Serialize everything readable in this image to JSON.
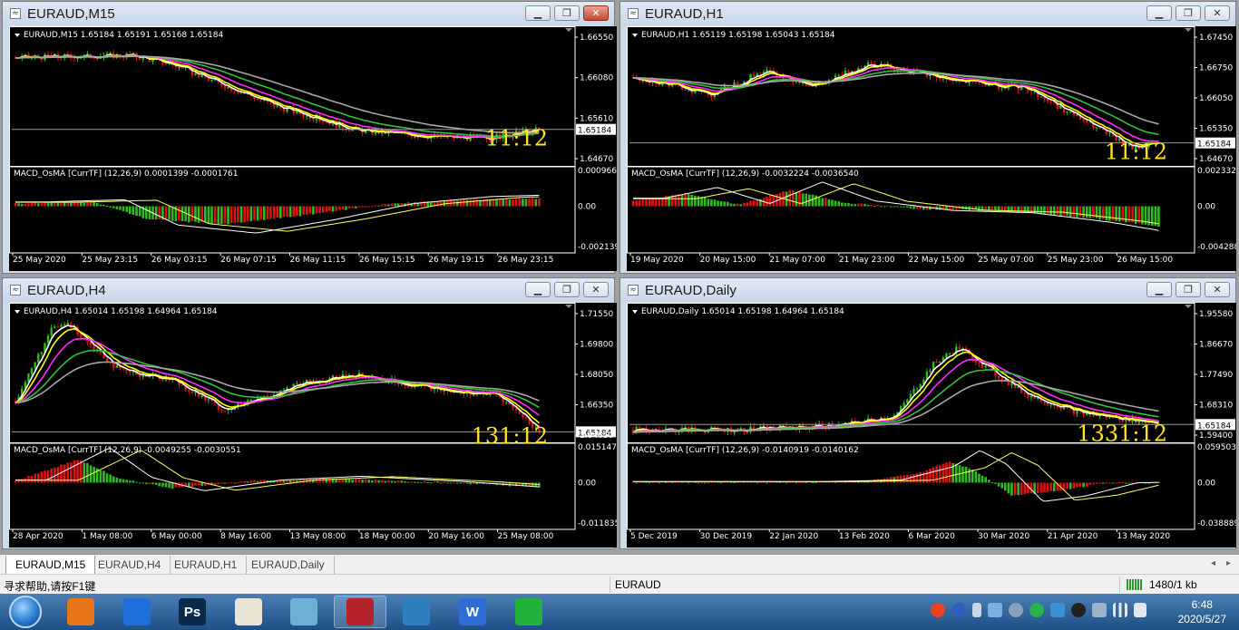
{
  "windows": [
    {
      "id": "m15",
      "title": "EURAUD,M15",
      "ohlc_header": "EURAUD,M15  1.65184 1.65191 1.65168 1.65184",
      "price_labels": [
        "1.66550",
        "1.66080",
        "1.65610",
        "1.64670"
      ],
      "current_price": "1.65184",
      "timer": "11:12",
      "macd_header": "MACD_OsMA [CurrTF] (12,26,9) 0.0001399 -0.0001761",
      "macd_labels": [
        "0.000966",
        "0.00",
        "-0.002139"
      ],
      "time_labels": [
        "25 May 2020",
        "25 May 23:15",
        "26 May 03:15",
        "26 May 07:15",
        "26 May 11:15",
        "26 May 15:15",
        "26 May 19:15",
        "26 May 23:15"
      ],
      "active": true
    },
    {
      "id": "h1",
      "title": "EURAUD,H1",
      "ohlc_header": "EURAUD,H1  1.65119 1.65198 1.65043 1.65184",
      "price_labels": [
        "1.67450",
        "1.66750",
        "1.66050",
        "1.65350",
        "1.64670"
      ],
      "current_price": "1.65184",
      "timer": "11:12",
      "macd_header": "MACD_OsMA [CurrTF] (12,26,9) -0.0032224 -0.0036540",
      "macd_labels": [
        "0.0023327",
        "0.00",
        "-0.004288"
      ],
      "time_labels": [
        "19 May 2020",
        "20 May 15:00",
        "21 May 07:00",
        "21 May 23:00",
        "22 May 15:00",
        "25 May 07:00",
        "25 May 23:00",
        "26 May 15:00"
      ],
      "active": false
    },
    {
      "id": "h4",
      "title": "EURAUD,H4",
      "ohlc_header": "EURAUD,H4  1.65014 1.65198 1.64964 1.65184",
      "price_labels": [
        "1.71550",
        "1.69800",
        "1.68050",
        "1.66350",
        "1.64650"
      ],
      "current_price": "1.65184",
      "timer": "131:12",
      "macd_header": "MACD_OsMA [CurrTF] (12,26,9) -0.0049255 -0.0030551",
      "macd_labels": [
        "0.0151478",
        "0.00",
        "-0.011835"
      ],
      "time_labels": [
        "28 Apr 2020",
        "1 May 08:00",
        "6 May 00:00",
        "8 May 16:00",
        "13 May 08:00",
        "18 May 00:00",
        "20 May 16:00",
        "25 May 08:00"
      ],
      "active": false
    },
    {
      "id": "daily",
      "title": "EURAUD,Daily",
      "ohlc_header": "EURAUD,Daily  1.65014 1.65198 1.64964 1.65184",
      "price_labels": [
        "1.95580",
        "1.86670",
        "1.77490",
        "1.68310",
        "1.59400"
      ],
      "current_price": "1.65184",
      "timer": "1331:12",
      "macd_header": "MACD_OsMA [CurrTF] (12,26,9) -0.0140919 -0.0140162",
      "macd_labels": [
        "0.0595038",
        "0.00",
        "-0.038889"
      ],
      "time_labels": [
        "5 Dec 2019",
        "30 Dec 2019",
        "22 Jan 2020",
        "13 Feb 2020",
        "6 Mar 2020",
        "30 Mar 2020",
        "21 Apr 2020",
        "13 May 2020"
      ],
      "active": false
    }
  ],
  "tabs": [
    "EURAUD,M15",
    "EURAUD,H4",
    "EURAUD,H1",
    "EURAUD,Daily"
  ],
  "status": {
    "help": "寻求帮助,请按F1键",
    "symbol": "EURAUD",
    "traffic": "1480/1 kb"
  },
  "clock": {
    "time": "6:48",
    "date": "2020/5/27"
  },
  "taskbar_apps": [
    {
      "name": "foxmail-icon",
      "label": "",
      "color": "#e8741c"
    },
    {
      "name": "mountain-app-icon",
      "label": "",
      "color": "#1e6fd9"
    },
    {
      "name": "photoshop-icon",
      "label": "Ps",
      "color": "#0a2a4a"
    },
    {
      "name": "paint-app-icon",
      "label": "",
      "color": "#e9e4d4"
    },
    {
      "name": "notebook-app-icon",
      "label": "",
      "color": "#6bb1d6"
    },
    {
      "name": "uk-flag-metatrader-icon",
      "label": "",
      "color": "#b4232c"
    },
    {
      "name": "image-viewer-icon",
      "label": "",
      "color": "#2e7fbf"
    },
    {
      "name": "wps-writer-icon",
      "label": "W",
      "color": "#2b6fd6"
    },
    {
      "name": "wechat-icon",
      "label": "",
      "color": "#22b33a"
    }
  ],
  "colors": {
    "bull": "#2dbb1f",
    "bear": "#e0120e",
    "ema_fast": "#ffffff",
    "ema_mid": "#ffff00",
    "ema_magenta": "#ff2cff",
    "ema_green": "#36c03a",
    "ema_gray": "#a6a6a6",
    "timer": "#ffe41a"
  }
}
